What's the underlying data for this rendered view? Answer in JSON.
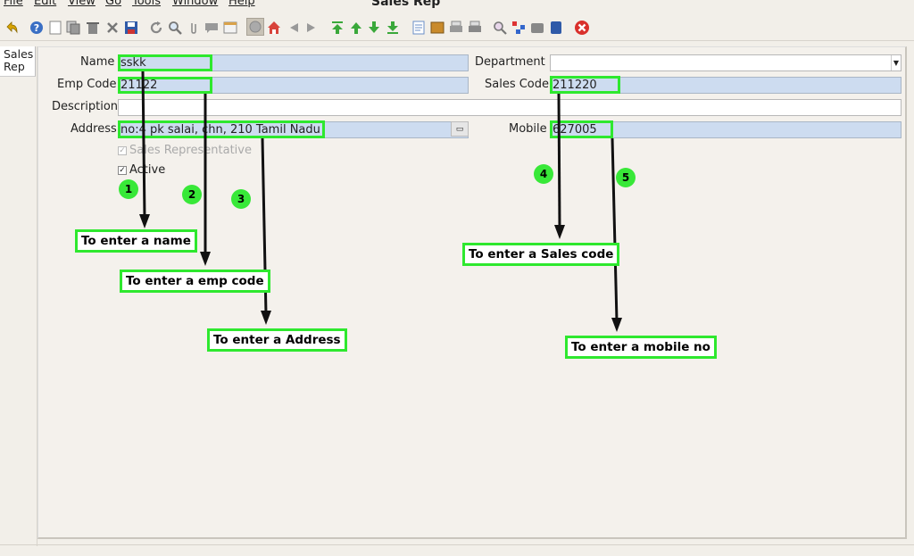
{
  "window": {
    "title": "Sales Rep"
  },
  "menu": [
    "File",
    "Edit",
    "View",
    "Go",
    "Tools",
    "Window",
    "Help"
  ],
  "toolbar": {
    "icons": [
      "undo-icon",
      "help-icon",
      "new-icon",
      "copy-icon",
      "delete-icon",
      "delete-selection-icon",
      "save-icon",
      "refresh-icon",
      "find-icon",
      "attachment-icon",
      "chat-icon",
      "history-icon",
      "grid-toggle-icon",
      "home-icon",
      "previous-page-icon",
      "next-page-icon",
      "first-record-icon",
      "previous-record-icon",
      "next-record-icon",
      "last-record-icon",
      "report-icon",
      "archive-icon",
      "print-preview-icon",
      "print-icon",
      "zoom-across-icon",
      "workflow-icon",
      "request-icon",
      "product-info-icon",
      "exit-icon"
    ]
  },
  "side_tab": {
    "label": "Sales Rep"
  },
  "form": {
    "name": {
      "label": "Name",
      "value": "sskk"
    },
    "department": {
      "label": "Department",
      "value": ""
    },
    "emp_code": {
      "label": "Emp Code",
      "value": "21122"
    },
    "sales_code": {
      "label": "Sales Code",
      "value": "211220"
    },
    "description": {
      "label": "Description",
      "value": ""
    },
    "address": {
      "label": "Address",
      "value": "no:4 pk salai, chn,  210 Tamil Nadu"
    },
    "mobile": {
      "label": "Mobile",
      "value": "627005"
    },
    "sales_representative": {
      "label": "Sales Representative",
      "checked": true
    },
    "active": {
      "label": "Active",
      "checked": true
    }
  },
  "annotations": [
    {
      "number": "1",
      "text": "To enter a name"
    },
    {
      "number": "2",
      "text": "To enter a emp code"
    },
    {
      "number": "3",
      "text": "To enter a Address"
    },
    {
      "number": "4",
      "text": "To enter a Sales code"
    },
    {
      "number": "5",
      "text": "To enter a mobile no"
    }
  ],
  "colors": {
    "field_bg": "#cddcf0",
    "highlight": "#2ee82e",
    "badge": "#38e838"
  }
}
